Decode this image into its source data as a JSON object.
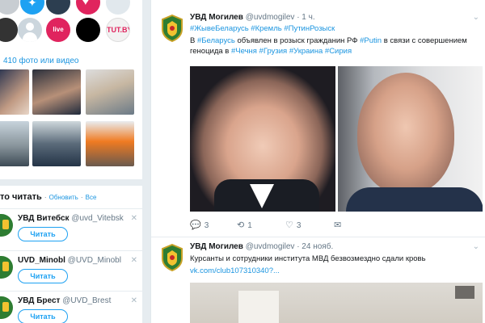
{
  "left": {
    "avatars": [
      {
        "name": "avatar-1"
      },
      {
        "name": "avatar-2"
      },
      {
        "name": "avatar-3"
      },
      {
        "name": "avatar-4"
      },
      {
        "name": "avatar-5"
      },
      {
        "name": "avatar-6"
      },
      {
        "name": "avatar-7"
      },
      {
        "name": "avatar-8",
        "text": "live"
      },
      {
        "name": "avatar-9"
      },
      {
        "name": "avatar-10",
        "text": "TUT.BY"
      }
    ],
    "media_link": "410 фото или видео",
    "who_to_follow": {
      "title": "то читать",
      "refresh": "Обновить",
      "separator": "·",
      "all": "Все",
      "items": [
        {
          "name": "УВД Витебск",
          "handle": "@uvd_Vitebsk",
          "button": "Читать"
        },
        {
          "name": "UVD_Minobl",
          "handle": "@UVD_Minobl",
          "button": "Читать"
        },
        {
          "name": "УВД Брест",
          "handle": "@UVD_Brest",
          "button": "Читать"
        }
      ]
    }
  },
  "tweets": [
    {
      "author": "УВД Могилев",
      "handle": "@uvdmogilev",
      "time": "· 1 ч.",
      "hashtags": "#ЖывеБеларусь #Кремль #ПутинРозыск",
      "text_parts": {
        "p1": "В ",
        "h1": "#Беларусь",
        "p2": " объявлен в розыск гражданин РФ ",
        "h2": "#Putin",
        "p3": " в связи с совершением геноцида в ",
        "h3": "#Чечня #Грузия #Украина #Сирия"
      },
      "replies": "3",
      "retweets": "1",
      "likes": "3"
    },
    {
      "author": "УВД Могилев",
      "handle": "@uvdmogilev",
      "time": "· 24 нояб.",
      "text": "Курсанты и сотрудники института МВД безвозмездно сдали кровь",
      "link": "vk.com/club107310340?..."
    }
  ],
  "icons": {
    "reply": "💬",
    "retweet": "⟲",
    "like": "♡",
    "message": "✉",
    "caret": "⌄",
    "dismiss": "✕"
  }
}
